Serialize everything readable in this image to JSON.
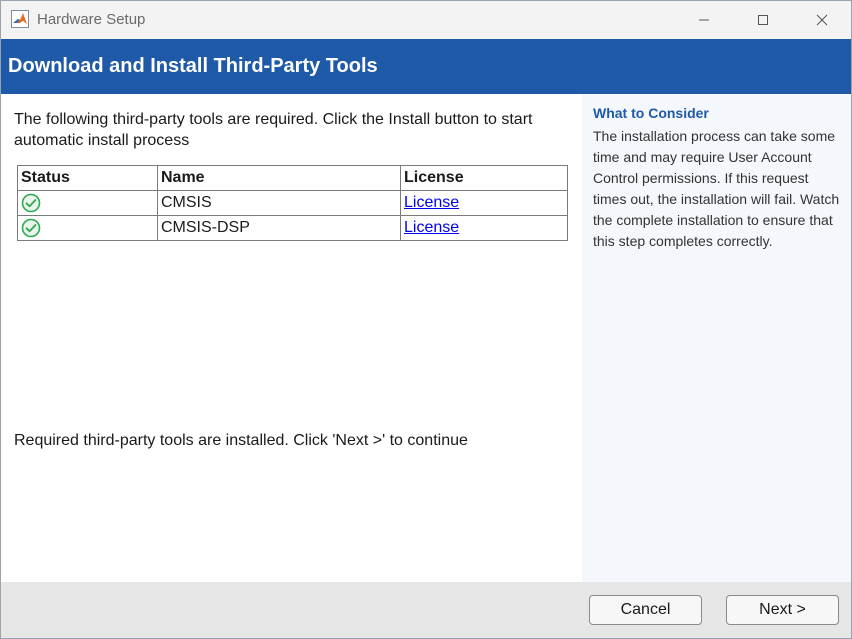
{
  "window": {
    "title": "Hardware Setup",
    "app_icon": "matlab-icon",
    "controls": [
      "minimize-icon",
      "maximize-icon",
      "close-icon"
    ]
  },
  "banner": {
    "title": "Download and Install Third-Party Tools",
    "color": "#1e5aa8"
  },
  "main": {
    "intro": "The following third-party tools are required. Click the Install button to start automatic install process",
    "table": {
      "headers": [
        "Status",
        "Name",
        "License"
      ],
      "rows": [
        {
          "status": "check-icon",
          "name": "CMSIS",
          "license": "License"
        },
        {
          "status": "check-icon",
          "name": "CMSIS-DSP",
          "license": "License"
        }
      ]
    },
    "status_message": "Required third-party tools are installed. Click 'Next >' to continue"
  },
  "side": {
    "title": "What to Consider",
    "text": "The installation process can take some time and may require User Account Control permissions. If this request times out, the installation will fail. Watch the complete installation to ensure that this step completes correctly."
  },
  "footer": {
    "cancel_label": "Cancel",
    "next_label": "Next >"
  },
  "colors": {
    "accent": "#1e5aa8",
    "success": "#2fa84f",
    "link": "#0000ee"
  }
}
